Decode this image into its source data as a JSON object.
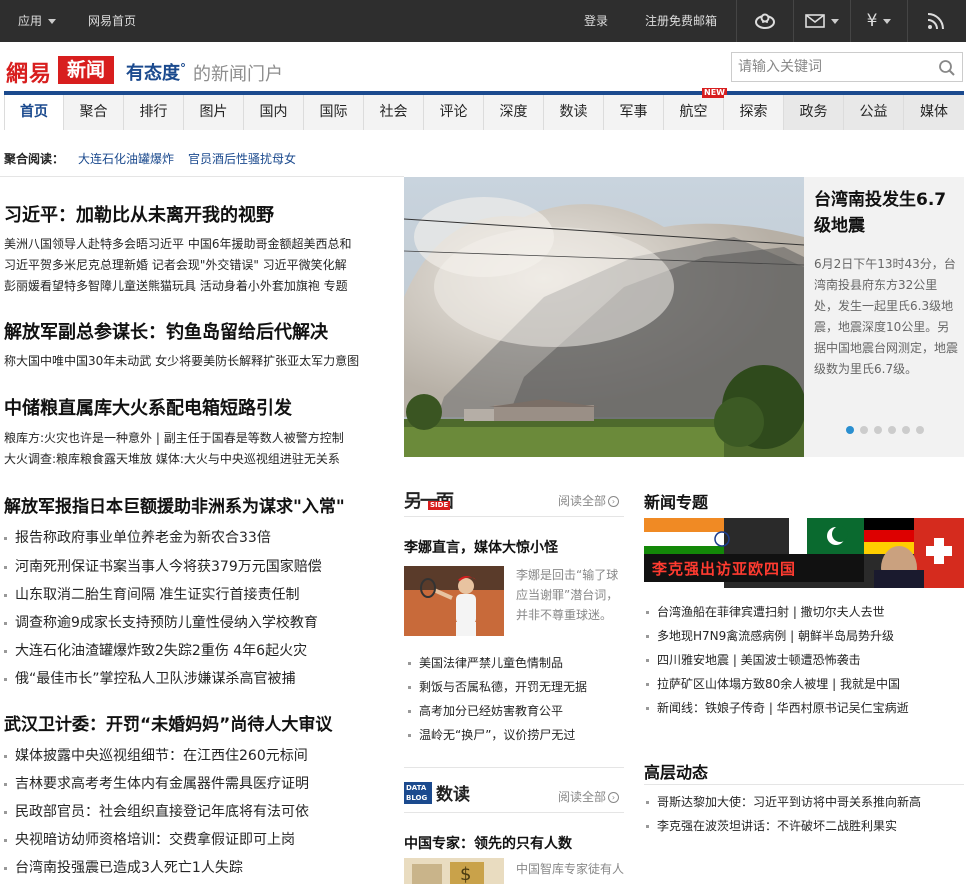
{
  "topbar": {
    "apps": "应用",
    "home": "网易首页",
    "login": "登录",
    "register": "注册免费邮箱",
    "icons": [
      "user-icon",
      "mail-icon",
      "yen-icon",
      "rss-icon"
    ]
  },
  "logo": {
    "wangyi": "網易",
    "xinwen": "新闻",
    "slogan_bold": "有态度",
    "slogan_mark": "°",
    "slogan_rest": "的新闻门户"
  },
  "search": {
    "placeholder": "请输入关键词"
  },
  "nav": {
    "items": [
      "首页",
      "聚合",
      "排行",
      "图片",
      "国内",
      "国际",
      "社会",
      "评论",
      "深度",
      "数读",
      "军事",
      "航空",
      "探索",
      "政务",
      "公益",
      "媒体"
    ],
    "new_badge": "NEW"
  },
  "aggregate": {
    "label": "聚合阅读：",
    "links": [
      "大连石化油罐爆炸",
      "官员酒后性骚扰母女"
    ]
  },
  "left": {
    "s1": {
      "title": "习近平：加勒比从未离开我的视野",
      "lines": [
        "美洲八国领导人赴特多会晤习近平 中国6年援助哥金额超美西总和",
        "习近平贺多米尼克总理新婚 记者会现\"外交错误\" 习近平微笑化解",
        "彭丽媛看望特多智障儿童送熊猫玩具 活动身着小外套加旗袍 专题"
      ]
    },
    "s2": {
      "title": "解放军副总参谋长：钓鱼岛留给后代解决",
      "lines": [
        "称大国中唯中国30年未动武 女少将要美防长解释扩张亚太军力意图"
      ]
    },
    "s3": {
      "title": "中储粮直属库大火系配电箱短路引发",
      "lines": [
        "粮库方:火灾也许是一种意外 | 副主任于国春是等数人被警方控制",
        "大火调查:粮库粮食露天堆放 媒体:大火与中央巡视组进驻无关系"
      ]
    },
    "s4": {
      "title": "解放军报指日本巨额援助非洲系为谋求\"入常\"",
      "items": [
        "报告称政府事业单位养老金为新农合33倍",
        "河南死刑保证书案当事人今将获379万元国家赔偿",
        "山东取消二胎生育间隔 准生证实行首接责任制",
        "调查称逾9成家长支持预防儿童性侵纳入学校教育",
        "大连石化油渣罐爆炸致2失踪2重伤 4年6起火灾",
        "俄“最佳市长”掌控私人卫队涉嫌谋杀高官被捕"
      ]
    },
    "s5": {
      "title": "武汉卫计委：开罚“未婚妈妈”尚待人大审议",
      "items": [
        "媒体披露中央巡视组细节：在江西住260元标间",
        "吉林要求高考考生体内有金属器件需具医疗证明",
        "民政部官员：社会组织直接登记年底将有法可依",
        "央视暗访幼师资格培训：交费拿假证即可上岗",
        "台湾南投强震已造成3人死亡1人失踪"
      ]
    }
  },
  "slideshow": {
    "title": "台湾南投发生6.7级地震",
    "desc": "6月2日下午13时43分，台湾南投县府东方32公里处，发生一起里氏6.3级地震，地震深度10公里。另据中国地震台网测定，地震级数为里氏6.7级。",
    "dots": 6,
    "active_dot": 1
  },
  "middle": {
    "linmian": {
      "logo": "另一面",
      "logo_side": "SIDE",
      "more": "阅读全部",
      "headline": "李娜直言，媒体大惊小怪",
      "desc": "李娜是回击“输了球应当谢罪”潜台词，并非不尊重球迷。",
      "items": [
        "美国法律严禁儿童色情制品",
        "剩饭与否属私德，开罚无理无据",
        "高考加分已经妨害教育公平",
        "温岭无“换尸”，议价捞尸无过"
      ]
    },
    "shudu": {
      "logo_box": "DATA BLOG",
      "logo": "数读",
      "more": "阅读全部",
      "headline": "中国专家：领先的只有人数",
      "desc": "中国智库专家徒有人"
    }
  },
  "right": {
    "topics": {
      "title": "新闻专题",
      "banner_text": "李克强出访亚欧四国",
      "items": [
        "台湾渔船在菲律宾遭扫射 | 撒切尔夫人去世",
        "多地现H7N9禽流感病例 | 朝鲜半岛局势升级",
        "四川雅安地震 | 美国波士顿遭恐怖袭击",
        "拉萨矿区山体塌方致80余人被埋 | 我就是中国",
        "新闻线：铁娘子传奇 | 华西村原书记吴仁宝病逝"
      ]
    },
    "leaders": {
      "title": "高层动态",
      "items": [
        "哥斯达黎加大使：习近平到访将中哥关系推向新高",
        "李克强在波茨坦讲话：不许破坏二战胜利果实"
      ]
    }
  },
  "colors": {
    "brand_red": "#d81e1e",
    "brand_blue": "#1b4a8e",
    "topbar": "#2e2e2e"
  }
}
